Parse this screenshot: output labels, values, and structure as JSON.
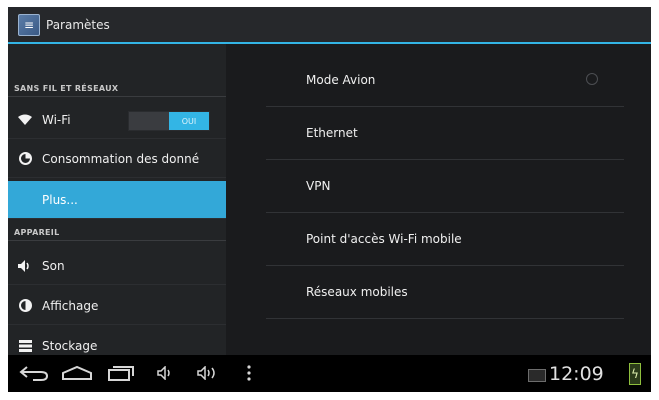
{
  "app": {
    "title": "Paramètes",
    "icon": "settings-app-icon"
  },
  "left_pane": {
    "sections": [
      {
        "header": "SANS FIL ET RÉSEAUX"
      },
      {
        "header": "APPAREIL"
      }
    ],
    "items": [
      {
        "label": "Wi-Fi",
        "icon": "wifi-icon"
      },
      {
        "label": "Consommation des donné",
        "icon": "data-usage-icon"
      },
      {
        "label": "Plus...",
        "selected": true
      },
      {
        "label": "Son",
        "icon": "sound-icon"
      },
      {
        "label": "Affichage",
        "icon": "display-icon"
      },
      {
        "label": "Stockage",
        "icon": "storage-icon"
      }
    ],
    "wifi_toggle": {
      "state_label": "OUI"
    }
  },
  "right_pane": {
    "items": [
      {
        "label": "Mode Avion"
      },
      {
        "label": "Ethernet"
      },
      {
        "label": "VPN"
      },
      {
        "label": "Point d'accès Wi-Fi mobile"
      },
      {
        "label": "Réseaux mobiles"
      }
    ]
  },
  "system_bar": {
    "clock": "12:09",
    "buttons": [
      "back-icon",
      "home-icon",
      "recent-apps-icon",
      "volume-down-icon",
      "volume-up-icon",
      "menu-icon"
    ]
  },
  "colors": {
    "accent": "#33b5e5",
    "selected_item": "#33a8d8",
    "background": "#1e1f21"
  }
}
